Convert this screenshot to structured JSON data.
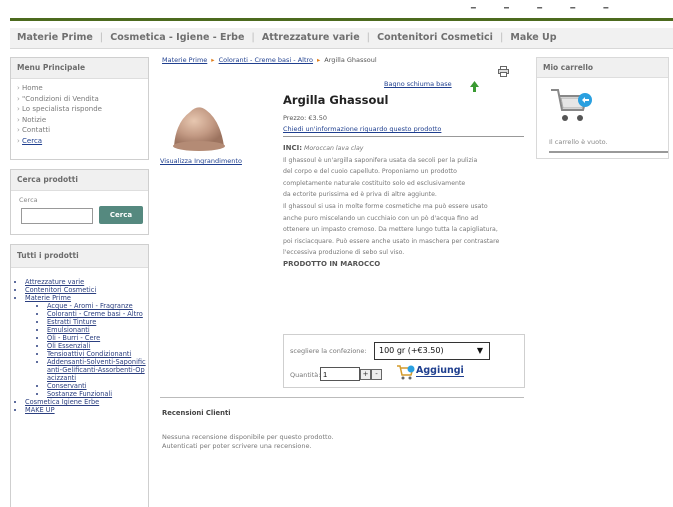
{
  "nav": {
    "items": [
      "Materie Prime",
      "Cosmetica - Igiene - Erbe",
      "Attrezzature varie",
      "Contenitori Cosmetici",
      "Make Up"
    ]
  },
  "menu": {
    "title": "Menu Principale",
    "items": [
      "Home",
      "\"Condizioni di Vendita",
      "Lo specialista risponde",
      "Notizie",
      "Contatti"
    ],
    "active_item": "Cerca"
  },
  "search": {
    "title": "Cerca prodotti",
    "label": "Cerca",
    "button": "Cerca",
    "value": ""
  },
  "all_products": {
    "title": "Tutti i prodotti",
    "top": [
      "Attrezzature varie",
      "Contenitori Cosmetici",
      "Materie Prime"
    ],
    "sub": [
      "Acque - Aromi - Fragranze",
      "Coloranti - Creme basi - Altro",
      "Estratti Tinture",
      "Emulsionanti",
      "Oli - Burri - Cere",
      "Oli Essenziali",
      "Tensioattivi Condizionanti",
      "Addensanti-Solventi-Saponificanti-Gelificanti-Assorbenti-Opacizzanti",
      "Conservanti",
      "Sostanze Funzionali"
    ],
    "bottom": [
      "Cosmetica Igiene Erbe",
      "MAKE UP"
    ]
  },
  "breadcrumb": [
    "Materie Prime",
    "Coloranti - Creme basi - Altro",
    "Argilla Ghassoul"
  ],
  "product": {
    "related_link": "Bagno schiuma base",
    "image_link": "Visualizza Ingrandimento",
    "title": "Argilla Ghassoul",
    "price": "Prezzo: €3.50",
    "ask_link": "Chiedi un'informazione riguardo questo prodotto",
    "inci_label": "INCI:",
    "inci_value": "Moroccan lava clay",
    "desc_lines": [
      "Il ghassoul è un'argilla saponifera usata da secoli per la pulizia",
      "del corpo e del cuoio capelluto. Proponiamo un prodotto",
      "completamente naturale costituito solo ed esclusivamente",
      "da ectorite purissima ed è priva di altre aggiunte.",
      "Il ghassoul si usa in molte forme cosmetiche ma può essere usato",
      "anche puro miscelando un cucchiaio con un pò d'acqua fino ad",
      "ottenere un impasto cremoso. Da mettere lungo tutta la capigliatura,",
      "poi risciacquare. Può essere anche usato in maschera per contrastare",
      "l'eccessiva produzione di sebo sul viso."
    ],
    "origin": "PRODOTTO IN MAROCCO"
  },
  "order": {
    "choose_label": "scegliere la confezione:",
    "select_value": "100 gr (+€3.50)",
    "qty_label": "Quantità:",
    "qty_value": "1",
    "add_button": "Aggiungi"
  },
  "reviews": {
    "title": "Recensioni Clienti",
    "line1": "Nessuna recensione disponibile per questo prodotto.",
    "line2": "Autenticati per poter scrivere una recensione."
  },
  "cart": {
    "title": "Mio carrello",
    "empty": "Il carrello è vuoto."
  },
  "colors": {
    "brand_green": "#4c6a1e",
    "link_blue": "#1f3f8f",
    "accent_orange": "#e07d1a",
    "cart_blue": "#2aa0e0"
  }
}
